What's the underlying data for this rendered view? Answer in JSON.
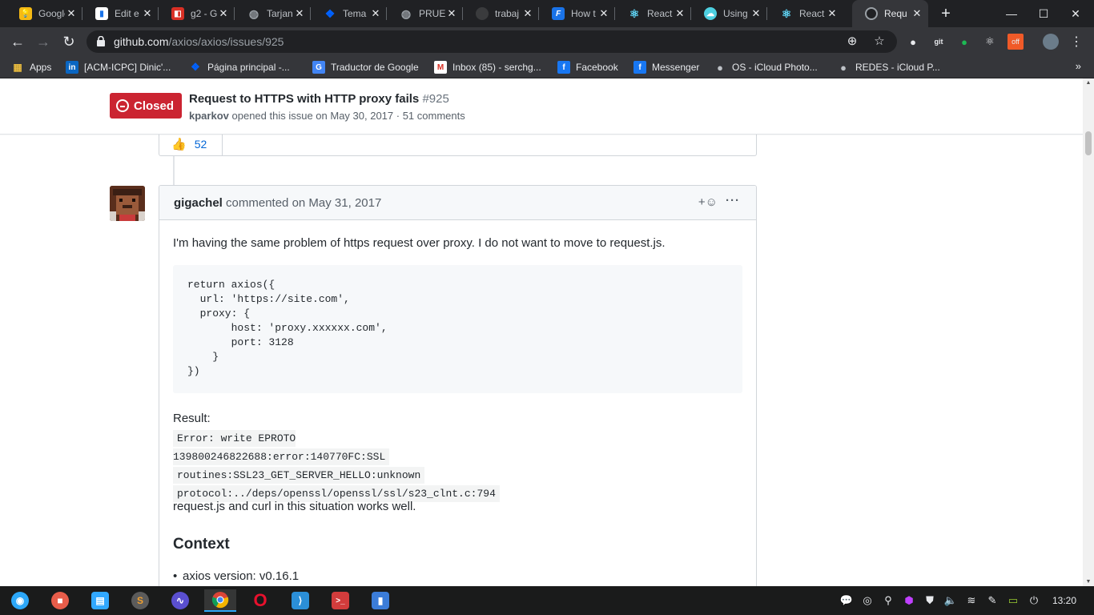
{
  "browser": {
    "tabs": [
      {
        "title": "Google",
        "icon": "google-keep-icon",
        "color": "#f5ba14"
      },
      {
        "title": "Edit e",
        "icon": "edit-doc-icon",
        "color": "#ffffff"
      },
      {
        "title": "g2 - G",
        "icon": "g2-icon",
        "color": "#d93025"
      },
      {
        "title": "Tarjan",
        "icon": "globe-icon",
        "color": "#9aa0a6"
      },
      {
        "title": "Tema",
        "icon": "dropbox-icon",
        "color": "#0061fe"
      },
      {
        "title": "PRUE",
        "icon": "globe-icon",
        "color": "#9aa0a6"
      },
      {
        "title": "trabaj",
        "icon": "github-icon",
        "color": "#3a3b3d"
      },
      {
        "title": "How t",
        "icon": "f-icon",
        "color": "#1a73e8"
      },
      {
        "title": "React",
        "icon": "react-icon",
        "color": "#61dafb"
      },
      {
        "title": "Using",
        "icon": "cloud-icon",
        "color": "#4dd0e1"
      },
      {
        "title": "React",
        "icon": "react-icon",
        "color": "#61dafb"
      },
      {
        "title": "Requ",
        "icon": "github-icon",
        "color": "#3a3b3d"
      }
    ],
    "url_host": "github.com",
    "url_path": "/axios/axios/issues/925",
    "bookmarks": [
      {
        "label": "Apps",
        "icon": "apps-grid-icon"
      },
      {
        "label": "[ACM-ICPC] Dinic'...",
        "icon": "linkedin-icon"
      },
      {
        "label": "Página principal -...",
        "icon": "dropbox-icon"
      },
      {
        "label": "Traductor de Google",
        "icon": "google-translate-icon"
      },
      {
        "label": "Inbox (85) - serchg...",
        "icon": "gmail-icon"
      },
      {
        "label": "Facebook",
        "icon": "facebook-icon"
      },
      {
        "label": "Messenger",
        "icon": "facebook-icon"
      },
      {
        "label": "OS - iCloud Photo...",
        "icon": "apple-icon"
      },
      {
        "label": "REDES - iCloud P...",
        "icon": "apple-icon"
      }
    ],
    "bookmarks_more": "»"
  },
  "issue": {
    "state": "Closed",
    "title": "Request to HTTPS with HTTP proxy fails",
    "number": "#925",
    "author": "kparkov",
    "meta": "opened this issue on May 30, 2017 · 51 comments",
    "reaction_emoji": "👍",
    "reaction_count": "52"
  },
  "comment": {
    "author": "gigachel",
    "action": "commented on May 31, 2017",
    "react_button": "+☺",
    "more_button": "···",
    "paragraph1": "I'm having the same problem of https request over proxy. I do not want to move to request.js.",
    "code": "return axios({\n  url: 'https://site.com',\n  proxy: {\n       host: 'proxy.xxxxxx.com',\n       port: 3128\n    }\n})",
    "result_label": "Result:",
    "error_lines": [
      "Error: write EPROTO 139800246822688:error:140770FC:SSL",
      "routines:SSL23_GET_SERVER_HELLO:unknown",
      "protocol:../deps/openssl/openssl/ssl/s23_clnt.c:794"
    ],
    "paragraph2": "request.js and curl in this situation works well.",
    "context_heading": "Context",
    "list_item": "axios version: v0.16.1"
  },
  "taskbar": {
    "apps": [
      {
        "name": "deepin-launcher-icon",
        "color": "#2ca7f8"
      },
      {
        "name": "screen-recorder-icon",
        "color": "#e85d4a"
      },
      {
        "name": "app-store-icon",
        "color": "#31a8ff"
      },
      {
        "name": "sublime-icon",
        "color": "#5b5b5b"
      },
      {
        "name": "system-monitor-icon",
        "color": "#5a4fcf"
      },
      {
        "name": "chrome-icon",
        "color": "#e8ad2f"
      },
      {
        "name": "opera-icon",
        "color": "#e8112d"
      },
      {
        "name": "vscode-icon",
        "color": "#2b8fd8"
      },
      {
        "name": "terminal-icon",
        "color": "#d23c3c"
      },
      {
        "name": "file-manager-icon",
        "color": "#3b7cd8"
      }
    ],
    "clock": "13:20"
  }
}
